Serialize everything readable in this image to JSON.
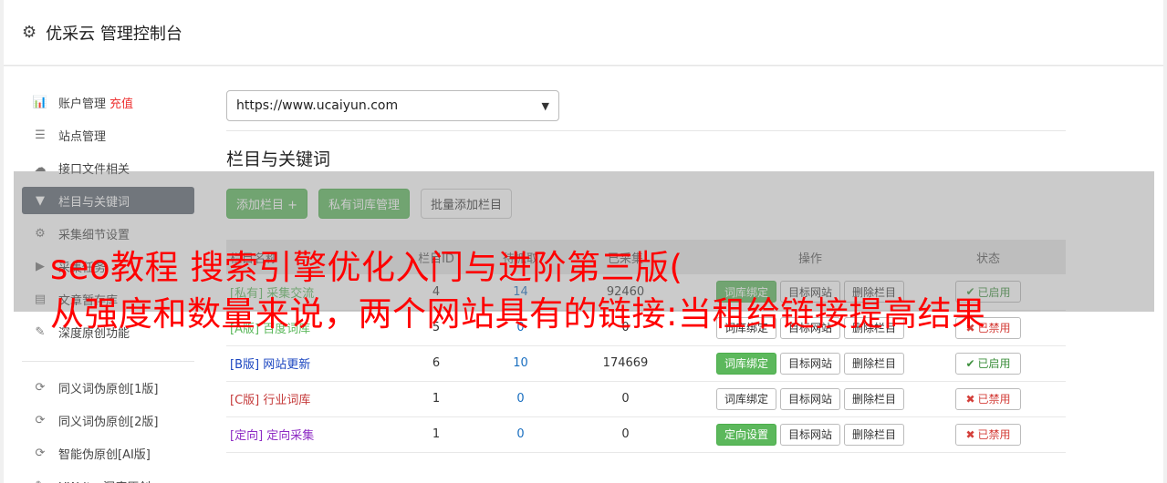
{
  "header": {
    "title": "优采云 管理控制台"
  },
  "sidebar": {
    "items": [
      {
        "label": "账户管理",
        "icon": "bar-chart-icon",
        "glyph": "📊",
        "extra": "充值",
        "active": false
      },
      {
        "label": "站点管理",
        "icon": "server-icon",
        "glyph": "☰",
        "active": false
      },
      {
        "label": "接口文件相关",
        "icon": "cloud-upload-icon",
        "glyph": "☁",
        "active": false
      },
      {
        "label": "栏目与关键词",
        "icon": "filter-icon",
        "glyph": "▼",
        "active": true
      },
      {
        "label": "采集细节设置",
        "icon": "cogs-icon",
        "glyph": "⚙",
        "active": false
      },
      {
        "label": "采集任务",
        "icon": "play-circle-icon",
        "glyph": "▶",
        "active": false
      },
      {
        "label": "文章暂存库",
        "icon": "database-icon",
        "glyph": "▤",
        "active": false
      },
      {
        "label": "深度原创功能",
        "icon": "edit-icon",
        "glyph": "✎",
        "active": false
      }
    ],
    "items2": [
      {
        "label": "同义词伪原创[1版]",
        "icon": "refresh-icon",
        "glyph": "⟳"
      },
      {
        "label": "同义词伪原创[2版]",
        "icon": "refresh-icon",
        "glyph": "⟳"
      },
      {
        "label": "智能伪原创[AI版]",
        "icon": "refresh-icon",
        "glyph": "⟳"
      },
      {
        "label": "UWriter深度原创",
        "icon": "edit-icon",
        "glyph": "✎"
      }
    ]
  },
  "main": {
    "site_select": "https://www.ucaiyun.com",
    "section_title": "栏目与关键词",
    "buttons": {
      "add": "添加栏目 +",
      "private": "私有词库管理",
      "batch": "批量添加栏目"
    }
  },
  "table": {
    "headers": [
      "栏目名称",
      "栏目ID",
      "待抓取",
      "已采集",
      "操作",
      "状态"
    ],
    "rows": [
      {
        "name": "[私有] 采集交流",
        "cls": "cat-priv",
        "id": "4",
        "pending": "14",
        "collected": "92460",
        "op1": "词库绑定",
        "op1_green": true,
        "op2": "目标网站",
        "op3": "删除栏目",
        "status": "已启用",
        "on": true
      },
      {
        "name": "[A版] 百度词库",
        "cls": "cat-a",
        "id": "5",
        "pending": "0",
        "collected": "0",
        "op1": "词库绑定",
        "op1_green": false,
        "op2": "目标网站",
        "op3": "删除栏目",
        "status": "已禁用",
        "on": false
      },
      {
        "name": "[B版] 网站更新",
        "cls": "cat-b",
        "id": "6",
        "pending": "10",
        "collected": "174669",
        "op1": "词库绑定",
        "op1_green": true,
        "op2": "目标网站",
        "op3": "删除栏目",
        "status": "已启用",
        "on": true
      },
      {
        "name": "[C版] 行业词库",
        "cls": "cat-c",
        "id": "1",
        "pending": "0",
        "collected": "0",
        "op1": "词库绑定",
        "op1_green": false,
        "op2": "目标网站",
        "op3": "删除栏目",
        "status": "已禁用",
        "on": false
      },
      {
        "name": "[定向] 定向采集",
        "cls": "cat-dir",
        "id": "1",
        "pending": "0",
        "collected": "0",
        "op1": "定向设置",
        "op1_green": true,
        "op2": "目标网站",
        "op3": "删除栏目",
        "status": "已禁用",
        "on": false
      }
    ]
  },
  "overlay": {
    "line1": "seo教程 搜索引擎优化入门与进阶第三版(",
    "line2": "从强度和数量来说，两个网站具有的链接:当租给链接提高结果"
  }
}
